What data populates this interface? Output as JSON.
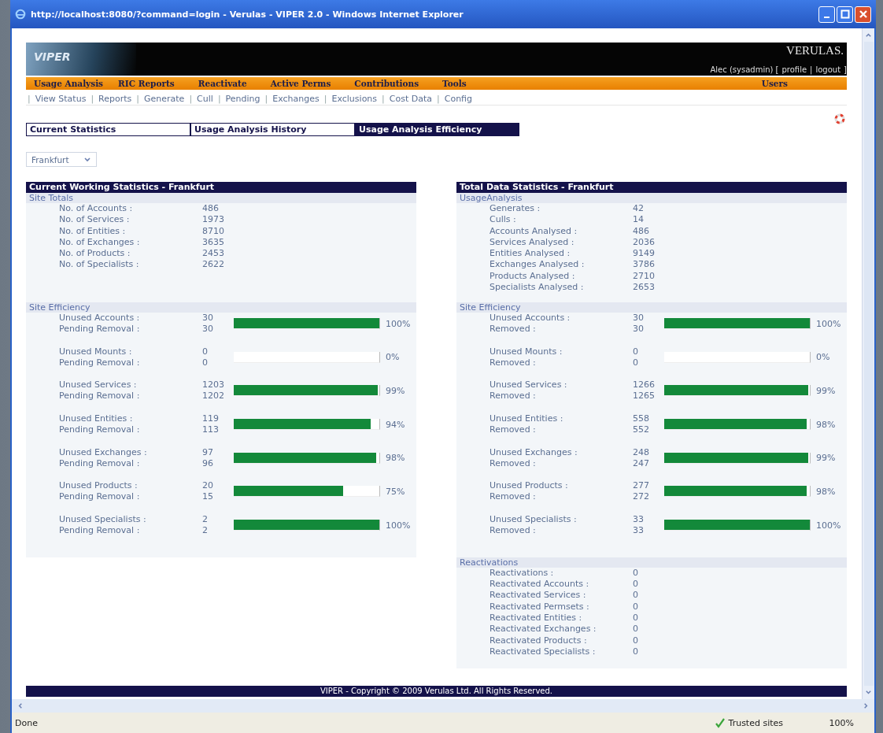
{
  "window": {
    "title": "http://localhost:8080/?command=login - Verulas - VIPER 2.0 - Windows Internet Explorer"
  },
  "header": {
    "logo": "VIPER",
    "brand": "VERULAS.",
    "user": "Alec (sysadmin) [",
    "links": [
      "profile",
      "logout"
    ],
    "separator": "|",
    "close": "]"
  },
  "menu": [
    "Usage Analysis",
    "RIC Reports",
    "Reactivate",
    "Active Perms",
    "Contributions",
    "Tools"
  ],
  "menu_right": "Users",
  "submenu": {
    "separator": "|",
    "items": [
      "View Status",
      "Reports",
      "Generate",
      "Cull",
      "Pending",
      "Exchanges",
      "Exclusions",
      "Cost Data",
      "Config"
    ]
  },
  "tabs": [
    {
      "label": "Current Statistics",
      "selected": false
    },
    {
      "label": "Usage Analysis History",
      "selected": false
    },
    {
      "label": "Usage Analysis Efficiency",
      "selected": true
    }
  ],
  "site_select": {
    "value": "Frankfurt"
  },
  "panels": [
    {
      "title": "Current Working Statistics - Frankfurt",
      "sections": [
        {
          "kind": "stats",
          "title": "Site Totals",
          "rows": [
            [
              "No. of Accounts :",
              "486"
            ],
            [
              "No. of Services :",
              "1973"
            ],
            [
              "No. of Entities :",
              "8710"
            ],
            [
              "No. of Exchanges :",
              "3635"
            ],
            [
              "No. of Products :",
              "2453"
            ],
            [
              "No. of Specialists :",
              "2622"
            ]
          ]
        },
        {
          "kind": "bars",
          "title": "Site Efficiency",
          "rows": [
            {
              "label": "Unused Accounts :",
              "value": "30",
              "label2": "Pending Removal :",
              "value2": "30",
              "level": 1,
              "percent": "100%"
            },
            {
              "label": "Unused Mounts :",
              "value": "0",
              "label2": "Pending Removal :",
              "value2": "0",
              "level": 0,
              "percent": "0%"
            },
            {
              "label": "Unused Services :",
              "value": "1203",
              "label2": "Pending Removal :",
              "value2": "1202",
              "level": 0.99,
              "percent": "99%"
            },
            {
              "label": "Unused Entities :",
              "value": "119",
              "label2": "Pending Removal :",
              "value2": "113",
              "level": 0.94,
              "percent": "94%"
            },
            {
              "label": "Unused Exchanges :",
              "value": "97",
              "label2": "Pending Removal :",
              "value2": "96",
              "level": 0.98,
              "percent": "98%"
            },
            {
              "label": "Unused Products :",
              "value": "20",
              "label2": "Pending Removal :",
              "value2": "15",
              "level": 0.75,
              "percent": "75%"
            },
            {
              "label": "Unused Specialists :",
              "value": "2",
              "label2": "Pending Removal :",
              "value2": "2",
              "level": 1,
              "percent": "100%"
            }
          ]
        }
      ]
    },
    {
      "title": "Total Data Statistics - Frankfurt",
      "sections": [
        {
          "kind": "stats",
          "title": "UsageAnalysis",
          "rows": [
            [
              "Generates :",
              "42"
            ],
            [
              "Culls :",
              "14"
            ],
            [
              "Accounts Analysed :",
              "486"
            ],
            [
              "Services Analysed :",
              "2036"
            ],
            [
              "Entities Analysed :",
              "9149"
            ],
            [
              "Exchanges Analysed :",
              "3786"
            ],
            [
              "Products Analysed :",
              "2710"
            ],
            [
              "Specialists Analysed :",
              "2653"
            ]
          ]
        },
        {
          "kind": "bars",
          "title": "Site Efficiency",
          "rows": [
            {
              "label": "Unused Accounts :",
              "value": "30",
              "label2": "Removed :",
              "value2": "30",
              "level": 1,
              "percent": "100%"
            },
            {
              "label": "Unused Mounts :",
              "value": "0",
              "label2": "Removed :",
              "value2": "0",
              "level": 0,
              "percent": "0%"
            },
            {
              "label": "Unused Services :",
              "value": "1266",
              "label2": "Removed :",
              "value2": "1265",
              "level": 0.99,
              "percent": "99%"
            },
            {
              "label": "Unused Entities :",
              "value": "558",
              "label2": "Removed :",
              "value2": "552",
              "level": 0.98,
              "percent": "98%"
            },
            {
              "label": "Unused Exchanges :",
              "value": "248",
              "label2": "Removed :",
              "value2": "247",
              "level": 0.99,
              "percent": "99%"
            },
            {
              "label": "Unused Products :",
              "value": "277",
              "label2": "Removed :",
              "value2": "272",
              "level": 0.98,
              "percent": "98%"
            },
            {
              "label": "Unused Specialists :",
              "value": "33",
              "label2": "Removed :",
              "value2": "33",
              "level": 1,
              "percent": "100%"
            }
          ]
        },
        {
          "kind": "stats",
          "title": "Reactivations",
          "rows": [
            [
              "Reactivations :",
              "0"
            ],
            [
              "Reactivated Accounts :",
              "0"
            ],
            [
              "Reactivated Services :",
              "0"
            ],
            [
              "Reactivated Permsets :",
              "0"
            ],
            [
              "Reactivated Entities :",
              "0"
            ],
            [
              "Reactivated Exchanges :",
              "0"
            ],
            [
              "Reactivated Products :",
              "0"
            ],
            [
              "Reactivated Specialists :",
              "0"
            ]
          ]
        }
      ]
    }
  ],
  "footer": "VIPER - Copyright © 2009 Verulas Ltd. All Rights Reserved.",
  "status_bar": {
    "text": "Done",
    "zone": "Trusted sites",
    "zoom": "100%"
  }
}
